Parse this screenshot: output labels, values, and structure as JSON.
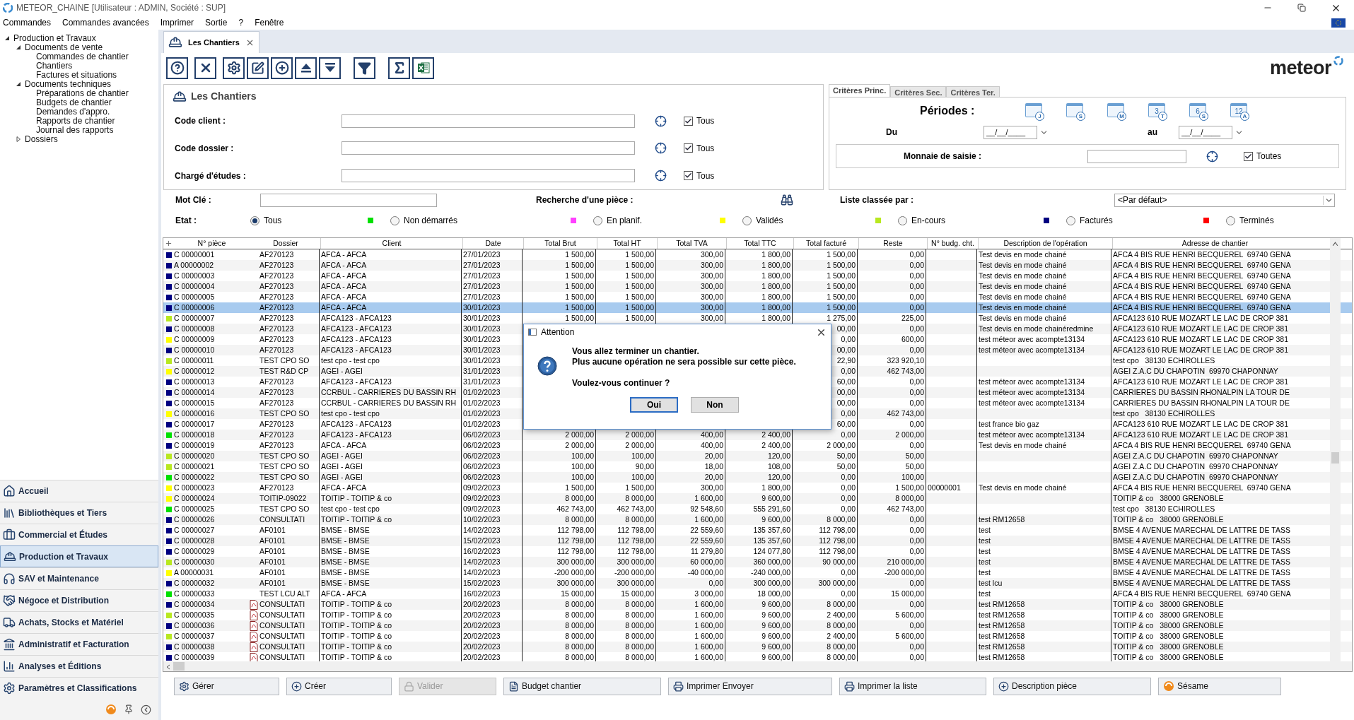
{
  "window": {
    "title": "METEOR_CHAINE [Utilisateur : ADMIN, Société : SUP]"
  },
  "menu": [
    "Commandes",
    "Commandes avancées",
    "Imprimer",
    "Sortie",
    "?",
    "Fenêtre"
  ],
  "sidebar": {
    "tree": [
      {
        "label": "Production et Travaux",
        "expanded": true,
        "children": [
          {
            "label": "Documents de vente",
            "expanded": true,
            "children": [
              {
                "label": "Commandes de chantier"
              },
              {
                "label": "Chantiers"
              },
              {
                "label": "Factures et situations"
              }
            ]
          },
          {
            "label": "Documents techniques",
            "expanded": true,
            "children": [
              {
                "label": "Préparations de chantier"
              },
              {
                "label": "Budgets de chantier"
              },
              {
                "label": "Demandes d'appro."
              },
              {
                "label": "Rapports de chantier"
              },
              {
                "label": "Journal des rapports"
              }
            ]
          },
          {
            "label": "Dossiers",
            "expanded": false
          }
        ]
      }
    ],
    "modules": [
      {
        "label": "Accueil",
        "selected": false
      },
      {
        "label": "Bibliothèques et Tiers",
        "selected": false
      },
      {
        "label": "Commercial et Études",
        "selected": false
      },
      {
        "label": "Production et Travaux",
        "selected": true
      },
      {
        "label": "SAV et Maintenance",
        "selected": false
      },
      {
        "label": "Négoce et Distribution",
        "selected": false
      },
      {
        "label": "Achats, Stocks et Matériel",
        "selected": false
      },
      {
        "label": "Administratif et Facturation",
        "selected": false
      },
      {
        "label": "Analyses et Éditions",
        "selected": false
      },
      {
        "label": "Paramètres et Classifications",
        "selected": false
      }
    ]
  },
  "tab": {
    "label": "Les Chantiers"
  },
  "logo": "meteor",
  "filters": {
    "title": "Les Chantiers",
    "fields": [
      {
        "label": "Code client :",
        "check_label": "Tous",
        "checked": true
      },
      {
        "label": "Code dossier :",
        "check_label": "Tous",
        "checked": true
      },
      {
        "label": "Chargé d'études :",
        "check_label": "Tous",
        "checked": true
      }
    ],
    "criteria_tabs": [
      {
        "label": "Critères Princ.",
        "selected": true
      },
      {
        "label": "Critères Sec.",
        "selected": false
      },
      {
        "label": "Critères Ter.",
        "selected": false
      }
    ],
    "periods_label": "Périodes :",
    "periods": [
      {
        "badge": "J"
      },
      {
        "badge": "S"
      },
      {
        "badge": "M"
      },
      {
        "number": "3",
        "badge": "T"
      },
      {
        "number": "6",
        "badge": "S"
      },
      {
        "number": "12",
        "badge": "A"
      }
    ],
    "from_label": "Du",
    "from_value": "__/__/____",
    "to_label": "au",
    "to_value": "__/__/____",
    "currency_label": "Monnaie de saisie :",
    "currency_check": "Toutes",
    "currency_checked": true,
    "keyword_label": "Mot Clé :",
    "search_piece_label": "Recherche d'une pièce :",
    "sort_label": "Liste classée par :",
    "sort_value": "<Par défaut>",
    "state_label": "Etat :",
    "states": [
      {
        "label": "Tous",
        "selected": true
      },
      {
        "label": "Non démarrés",
        "color": "#00e000",
        "selected": false
      },
      {
        "label": "En planif.",
        "color": "#ff40ff",
        "selected": false
      },
      {
        "label": "Validés",
        "color": "#ffff00",
        "selected": false
      },
      {
        "label": "En-cours",
        "color": "#b8e820",
        "selected": false
      },
      {
        "label": "Facturés",
        "color": "#000080",
        "selected": false
      },
      {
        "label": "Terminés",
        "color": "#ff0000",
        "selected": false
      }
    ]
  },
  "table": {
    "columns": [
      "N° pièce",
      "Dossier",
      "Client",
      "Date",
      "Total Brut",
      "Total HT",
      "Total TVA",
      "Total TTC",
      "Total facturé",
      "Reste",
      "N° budg. cht.",
      "Description de l'opération",
      "Adresse de chantier"
    ],
    "rows": [
      {
        "color": "#000080",
        "piece": "C 00000001",
        "pdf": false,
        "dossier": "AF270123",
        "client": "AFCA - AFCA",
        "date": "27/01/2023",
        "brut": "1 500,00",
        "ht": "1 500,00",
        "tva": "300,00",
        "ttc": "1 800,00",
        "facture": "1 500,00",
        "reste": "0,00",
        "description": "Test devis en mode chainé",
        "address": "AFCA 4 BIS RUE HENRI BECQUEREL  69740 GENA",
        "selected": false
      },
      {
        "color": "#000080",
        "piece": "A 00000002",
        "pdf": false,
        "dossier": "AF270123",
        "client": "AFCA - AFCA",
        "date": "27/01/2023",
        "brut": "1 500,00",
        "ht": "1 500,00",
        "tva": "300,00",
        "ttc": "1 800,00",
        "facture": "1 500,00",
        "reste": "0,00",
        "description": "Test devis en mode chainé",
        "address": "AFCA 4 BIS RUE HENRI BECQUEREL  69740 GENA",
        "selected": false
      },
      {
        "color": "#000080",
        "piece": "C 00000003",
        "pdf": false,
        "dossier": "AF270123",
        "client": "AFCA - AFCA",
        "date": "27/01/2023",
        "brut": "1 500,00",
        "ht": "1 500,00",
        "tva": "300,00",
        "ttc": "1 800,00",
        "facture": "1 500,00",
        "reste": "0,00",
        "description": "Test devis en mode chainé",
        "address": "AFCA 4 BIS RUE HENRI BECQUEREL  69740 GENA",
        "selected": false
      },
      {
        "color": "#000080",
        "piece": "C 00000004",
        "pdf": false,
        "dossier": "AF270123",
        "client": "AFCA - AFCA",
        "date": "27/01/2023",
        "brut": "1 500,00",
        "ht": "1 500,00",
        "tva": "300,00",
        "ttc": "1 800,00",
        "facture": "1 500,00",
        "reste": "0,00",
        "description": "Test devis en mode chainé",
        "address": "AFCA 4 BIS RUE HENRI BECQUEREL  69740 GENA",
        "selected": false
      },
      {
        "color": "#000080",
        "piece": "C 00000005",
        "pdf": false,
        "dossier": "AF270123",
        "client": "AFCA - AFCA",
        "date": "27/01/2023",
        "brut": "1 500,00",
        "ht": "1 500,00",
        "tva": "300,00",
        "ttc": "1 800,00",
        "facture": "1 500,00",
        "reste": "0,00",
        "description": "Test devis en mode chainé",
        "address": "AFCA 4 BIS RUE HENRI BECQUEREL  69740 GENA",
        "selected": false
      },
      {
        "color": "#000080",
        "piece": "C 00000006",
        "pdf": false,
        "dossier": "AF270123",
        "client": "AFCA - AFCA",
        "date": "30/01/2023",
        "brut": "1 500,00",
        "ht": "1 500,00",
        "tva": "300,00",
        "ttc": "1 800,00",
        "facture": "1 500,00",
        "reste": "0,00",
        "description": "Test devis en mode chainé",
        "address": "AFCA 4 BIS RUE HENRI BECQUEREL  69740 GENA",
        "selected": true
      },
      {
        "color": "#b8e820",
        "piece": "C 00000007",
        "pdf": false,
        "dossier": "AF270123",
        "client": "AFCA123 - AFCA123",
        "date": "30/01/2023",
        "brut": "1 500,00",
        "ht": "1 500,00",
        "tva": "300,00",
        "ttc": "1 800,00",
        "facture": "1 275,00",
        "reste": "225,00",
        "description": "Test devis en mode chainé",
        "address": "AFCA123 610 RUE MOZART LE LAC DE CROP 381",
        "selected": false
      },
      {
        "color": "#000080",
        "piece": "C 00000008",
        "pdf": false,
        "dossier": "AF270123",
        "client": "AFCA123 - AFCA123",
        "date": "30/01/2023",
        "facture": "00,00",
        "reste": "0,00",
        "description": "Test devis en mode chainéredmine",
        "address": "AFCA123 610 RUE MOZART LE LAC DE CROP 381",
        "selected": false
      },
      {
        "color": "#ffff00",
        "piece": "C 00000009",
        "pdf": false,
        "dossier": "AF270123",
        "client": "AFCA123 - AFCA123",
        "date": "30/01/2023",
        "facture": "0,00",
        "reste": "600,00",
        "description": "test méteor avec acompte13134",
        "address": "AFCA123 610 RUE MOZART LE LAC DE CROP 381",
        "selected": false
      },
      {
        "color": "#000080",
        "piece": "C 00000010",
        "pdf": false,
        "dossier": "AF270123",
        "client": "AFCA123 - AFCA123",
        "date": "30/01/2023",
        "facture": "00,00",
        "reste": "0,00",
        "description": "test méteor avec acompte13134",
        "address": "AFCA123 610 RUE MOZART LE LAC DE CROP 381",
        "selected": false
      },
      {
        "color": "#b8e820",
        "piece": "C 00000011",
        "pdf": false,
        "dossier": "TEST CPO SO",
        "client": "test cpo - test cpo",
        "date": "30/01/2023",
        "facture": "22,90",
        "reste": "323 920,10",
        "address": "test cpo   38130 ECHIROLLES",
        "selected": false
      },
      {
        "color": "#ffff00",
        "piece": "C 00000012",
        "pdf": false,
        "dossier": "TEST R&D CP",
        "client": "AGEI - AGEI",
        "date": "31/01/2023",
        "facture": "0,00",
        "reste": "462 743,00",
        "address": "AGEI Z.A.C DU CHAPOTIN  69970 CHAPONNAY",
        "selected": false
      },
      {
        "color": "#000080",
        "piece": "C 00000013",
        "pdf": false,
        "dossier": "AF270123",
        "client": "AFCA123 - AFCA123",
        "date": "31/01/2023",
        "facture": "60,00",
        "reste": "0,00",
        "description": "test méteor avec acompte13134",
        "address": "AFCA123 610 RUE MOZART LE LAC DE CROP 381",
        "selected": false
      },
      {
        "color": "#000080",
        "piece": "C 00000014",
        "pdf": false,
        "dossier": "AF270123",
        "client": "CCRBUL - CARRIERES DU BASSIN RH",
        "date": "01/02/2023",
        "facture": "00,00",
        "reste": "0,00",
        "description": "test méteor avec acompte13134",
        "address": "CARRIERES DU BASSIN RHONALPIN LA TOUR DE",
        "selected": false
      },
      {
        "color": "#000080",
        "piece": "C 00000015",
        "pdf": false,
        "dossier": "AF270123",
        "client": "CCRBUL - CARRIERES DU BASSIN RH",
        "date": "01/02/2023",
        "facture": "00,00",
        "reste": "0,00",
        "description": "test méteor avec acompte13134",
        "address": "CARRIERES DU BASSIN RHONALPIN LA TOUR DE",
        "selected": false
      },
      {
        "color": "#ffff00",
        "piece": "C 00000016",
        "pdf": false,
        "dossier": "TEST CPO SO",
        "client": "test cpo - test cpo",
        "date": "01/02/2023",
        "facture": "0,00",
        "reste": "462 743,00",
        "address": "test cpo   38130 ECHIROLLES",
        "selected": false
      },
      {
        "color": "#000080",
        "piece": "C 00000017",
        "pdf": false,
        "dossier": "AF270123",
        "client": "AFCA123 - AFCA123",
        "date": "01/02/2023",
        "facture": "60,00",
        "reste": "0,00",
        "description": "test france bio gaz",
        "address": "AFCA123 610 RUE MOZART LE LAC DE CROP 381",
        "selected": false
      },
      {
        "color": "#00e000",
        "piece": "C 00000018",
        "pdf": false,
        "dossier": "AF270123",
        "client": "AFCA123 - AFCA123",
        "date": "06/02/2023",
        "brut": "2 000,00",
        "ht": "2 000,00",
        "tva": "400,00",
        "ttc": "2 400,00",
        "facture": "0,00",
        "reste": "2 000,00",
        "description": "test méteor avec acompte13134",
        "address": "AFCA123 610 RUE MOZART LE LAC DE CROP 381",
        "selected": false
      },
      {
        "color": "#000080",
        "piece": "C 00000019",
        "pdf": false,
        "dossier": "AF270123",
        "client": "AFCA - AFCA",
        "date": "06/02/2023",
        "brut": "2 000,00",
        "ht": "2 000,00",
        "tva": "400,00",
        "ttc": "2 400,00",
        "facture": "2 000,00",
        "reste": "0,00",
        "description": "Test devis en mode chainé",
        "address": "AFCA 4 BIS RUE HENRI BECQUEREL  69740 GENA",
        "selected": false
      },
      {
        "color": "#b8e820",
        "piece": "C 00000020",
        "pdf": false,
        "dossier": "TEST CPO SO",
        "client": "AGEI - AGEI",
        "date": "06/02/2023",
        "brut": "100,00",
        "ht": "100,00",
        "tva": "20,00",
        "ttc": "120,00",
        "facture": "50,00",
        "reste": "50,00",
        "address": "AGEI Z.A.C DU CHAPOTIN  69970 CHAPONNAY",
        "selected": false
      },
      {
        "color": "#b8e820",
        "piece": "C 00000021",
        "pdf": false,
        "dossier": "TEST CPO SO",
        "client": "AGEI - AGEI",
        "date": "06/02/2023",
        "brut": "100,00",
        "ht": "90,00",
        "tva": "18,00",
        "ttc": "108,00",
        "facture": "50,00",
        "reste": "50,00",
        "address": "AGEI Z.A.C DU CHAPOTIN  69970 CHAPONNAY",
        "selected": false
      },
      {
        "color": "#00e000",
        "piece": "C 00000022",
        "pdf": false,
        "dossier": "TEST CPO SO",
        "client": "AGEI - AGEI",
        "date": "06/02/2023",
        "brut": "100,00",
        "ht": "100,00",
        "tva": "20,00",
        "ttc": "120,00",
        "facture": "0,00",
        "reste": "100,00",
        "address": "AGEI Z.A.C DU CHAPOTIN  69970 CHAPONNAY",
        "selected": false
      },
      {
        "color": "#ffff00",
        "piece": "C 00000023",
        "pdf": false,
        "dossier": "AF270123",
        "client": "AFCA - AFCA",
        "date": "09/02/2023",
        "brut": "1 500,00",
        "ht": "1 500,00",
        "tva": "300,00",
        "ttc": "1 800,00",
        "facture": "0,00",
        "reste": "1 500,00",
        "budget": "00000001",
        "description": "Test devis en mode chainé",
        "address": "AFCA 4 BIS RUE HENRI BECQUEREL  69740 GENA",
        "selected": false
      },
      {
        "color": "#ffff00",
        "piece": "C 00000024",
        "pdf": false,
        "dossier": "TOITIP-09022",
        "client": "TOITIP - TOITIP & co",
        "date": "09/02/2023",
        "brut": "8 000,00",
        "ht": "8 000,00",
        "tva": "1 600,00",
        "ttc": "9 600,00",
        "facture": "0,00",
        "reste": "8 000,00",
        "address": "TOITIP & co   38000 GRENOBLE",
        "selected": false
      },
      {
        "color": "#00e000",
        "piece": "C 00000025",
        "pdf": false,
        "dossier": "TEST CPO SO",
        "client": "test cpo - test cpo",
        "date": "09/02/2023",
        "brut": "462 743,00",
        "ht": "462 743,00",
        "tva": "92 548,60",
        "ttc": "555 291,60",
        "facture": "0,00",
        "reste": "462 743,00",
        "address": "test cpo   38130 ECHIROLLES",
        "selected": false
      },
      {
        "color": "#000080",
        "piece": "C 00000026",
        "pdf": false,
        "dossier": "CONSULTATI",
        "client": "TOITIP - TOITIP & co",
        "date": "10/02/2023",
        "brut": "8 000,00",
        "ht": "8 000,00",
        "tva": "1 600,00",
        "ttc": "9 600,00",
        "facture": "8 000,00",
        "reste": "0,00",
        "description": "test RM12658",
        "address": "TOITIP & co   38000 GRENOBLE",
        "selected": false
      },
      {
        "color": "#000080",
        "piece": "C 00000027",
        "pdf": false,
        "dossier": "AF0101",
        "client": "BMSE - BMSE",
        "date": "14/02/2023",
        "brut": "112 798,00",
        "ht": "112 798,00",
        "tva": "22 559,60",
        "ttc": "135 357,60",
        "facture": "112 798,00",
        "reste": "0,00",
        "description": "test",
        "address": "BMSE 4 AVENUE MARECHAL DE LATTRE DE TASS",
        "selected": false
      },
      {
        "color": "#000080",
        "piece": "C 00000028",
        "pdf": false,
        "dossier": "AF0101",
        "client": "BMSE - BMSE",
        "date": "15/02/2023",
        "brut": "112 798,00",
        "ht": "112 798,00",
        "tva": "22 559,60",
        "ttc": "135 357,60",
        "facture": "112 798,00",
        "reste": "0,00",
        "description": "test",
        "address": "BMSE 4 AVENUE MARECHAL DE LATTRE DE TASS",
        "selected": false
      },
      {
        "color": "#000080",
        "piece": "C 00000029",
        "pdf": false,
        "dossier": "AF0101",
        "client": "BMSE - BMSE",
        "date": "16/02/2023",
        "brut": "112 798,00",
        "ht": "112 798,00",
        "tva": "11 279,80",
        "ttc": "124 077,80",
        "facture": "112 798,00",
        "reste": "0,00",
        "description": "test",
        "address": "BMSE 4 AVENUE MARECHAL DE LATTRE DE TASS",
        "selected": false
      },
      {
        "color": "#b8e820",
        "piece": "C 00000030",
        "pdf": false,
        "dossier": "AF0101",
        "client": "BMSE - BMSE",
        "date": "14/02/2023",
        "brut": "300 000,00",
        "ht": "300 000,00",
        "tva": "60 000,00",
        "ttc": "360 000,00",
        "facture": "90 000,00",
        "reste": "210 000,00",
        "description": "test",
        "address": "BMSE 4 AVENUE MARECHAL DE LATTRE DE TASS",
        "selected": false
      },
      {
        "color": "#ffff00",
        "piece": "A 00000031",
        "pdf": false,
        "dossier": "AF0101",
        "client": "BMSE - BMSE",
        "date": "14/02/2023",
        "brut": "-200 000,00",
        "ht": "-200 000,00",
        "tva": "-40 000,00",
        "ttc": "-240 000,00",
        "facture": "0,00",
        "reste": "-200 000,00",
        "description": "test",
        "address": "BMSE 4 AVENUE MARECHAL DE LATTRE DE TASS",
        "selected": false
      },
      {
        "color": "#000080",
        "piece": "C 00000032",
        "pdf": false,
        "dossier": "AF0101",
        "client": "BMSE - BMSE",
        "date": "15/02/2023",
        "brut": "300 000,00",
        "ht": "300 000,00",
        "tva": "0,00",
        "ttc": "300 000,00",
        "facture": "300 000,00",
        "reste": "0,00",
        "description": "test lcu",
        "address": "BMSE 4 AVENUE MARECHAL DE LATTRE DE TASS",
        "selected": false
      },
      {
        "color": "#00e000",
        "piece": "C 00000033",
        "pdf": false,
        "dossier": "TEST LCU ALT",
        "client": "AFCA - AFCA",
        "date": "16/02/2023",
        "brut": "15 000,00",
        "ht": "15 000,00",
        "tva": "3 000,00",
        "ttc": "18 000,00",
        "facture": "0,00",
        "reste": "15 000,00",
        "description": "test",
        "address": "AFCA 4 BIS RUE HENRI BECQUEREL  69740 GENA",
        "selected": false
      },
      {
        "color": "#000080",
        "piece": "C 00000034",
        "pdf": true,
        "dossier": "CONSULTATI",
        "client": "TOITIP - TOITIP & co",
        "date": "20/02/2023",
        "brut": "8 000,00",
        "ht": "8 000,00",
        "tva": "1 600,00",
        "ttc": "9 600,00",
        "facture": "8 000,00",
        "reste": "0,00",
        "description": "test RM12658",
        "address": "TOITIP & co   38000 GRENOBLE",
        "selected": false
      },
      {
        "color": "#b8e820",
        "piece": "C 00000035",
        "pdf": true,
        "dossier": "CONSULTATI",
        "client": "TOITIP - TOITIP & co",
        "date": "20/02/2023",
        "brut": "8 000,00",
        "ht": "8 000,00",
        "tva": "1 600,00",
        "ttc": "9 600,00",
        "facture": "2 400,00",
        "reste": "5 600,00",
        "description": "test RM12658",
        "address": "TOITIP & co   38000 GRENOBLE",
        "selected": false
      },
      {
        "color": "#000080",
        "piece": "C 00000036",
        "pdf": true,
        "dossier": "CONSULTATI",
        "client": "TOITIP - TOITIP & co",
        "date": "20/02/2023",
        "brut": "8 000,00",
        "ht": "8 000,00",
        "tva": "1 600,00",
        "ttc": "9 600,00",
        "facture": "8 000,00",
        "reste": "0,00",
        "description": "test RM12658",
        "address": "TOITIP & co   38000 GRENOBLE",
        "selected": false
      },
      {
        "color": "#b8e820",
        "piece": "C 00000037",
        "pdf": true,
        "dossier": "CONSULTATI",
        "client": "TOITIP - TOITIP & co",
        "date": "20/02/2023",
        "brut": "8 000,00",
        "ht": "8 000,00",
        "tva": "1 600,00",
        "ttc": "9 600,00",
        "facture": "2 400,00",
        "reste": "5 600,00",
        "description": "test RM12658",
        "address": "TOITIP & co   38000 GRENOBLE",
        "selected": false
      },
      {
        "color": "#000080",
        "piece": "C 00000038",
        "pdf": true,
        "dossier": "CONSULTATI",
        "client": "TOITIP - TOITIP & co",
        "date": "20/02/2023",
        "brut": "8 000,00",
        "ht": "8 000,00",
        "tva": "1 600,00",
        "ttc": "9 600,00",
        "facture": "8 000,00",
        "reste": "0,00",
        "description": "test RM12658",
        "address": "TOITIP & co   38000 GRENOBLE",
        "selected": false
      },
      {
        "color": "#000080",
        "piece": "C 00000039",
        "pdf": true,
        "dossier": "CONSULTATI",
        "client": "TOITIP - TOITIP & co",
        "date": "20/02/2023",
        "brut": "8 000,00",
        "ht": "8 000,00",
        "tva": "1 600,00",
        "ttc": "9 600,00",
        "facture": "8 000,00",
        "reste": "0,00",
        "description": "test RM12658",
        "address": "TOITIP & co   38000 GRENOBLE",
        "selected": false
      }
    ]
  },
  "dialog": {
    "title": "Attention",
    "message": "Vous allez terminer un chantier.\nPlus aucune opération ne sera possible sur cette pièce.",
    "question": "Voulez-vous continuer ?",
    "buttons": [
      {
        "label": "Oui",
        "selected": true
      },
      {
        "label": "Non",
        "selected": false
      }
    ]
  },
  "actions": [
    {
      "label": "Gérer",
      "disabled": false
    },
    {
      "label": "Créer",
      "disabled": false
    },
    {
      "label": "Valider",
      "disabled": true
    },
    {
      "label": "Budget chantier",
      "disabled": false
    },
    {
      "label": "Imprimer Envoyer",
      "disabled": false
    },
    {
      "label": "Imprimer la liste",
      "disabled": false
    },
    {
      "label": "Description pièce",
      "disabled": false
    },
    {
      "label": "Sésame",
      "disabled": false
    }
  ]
}
